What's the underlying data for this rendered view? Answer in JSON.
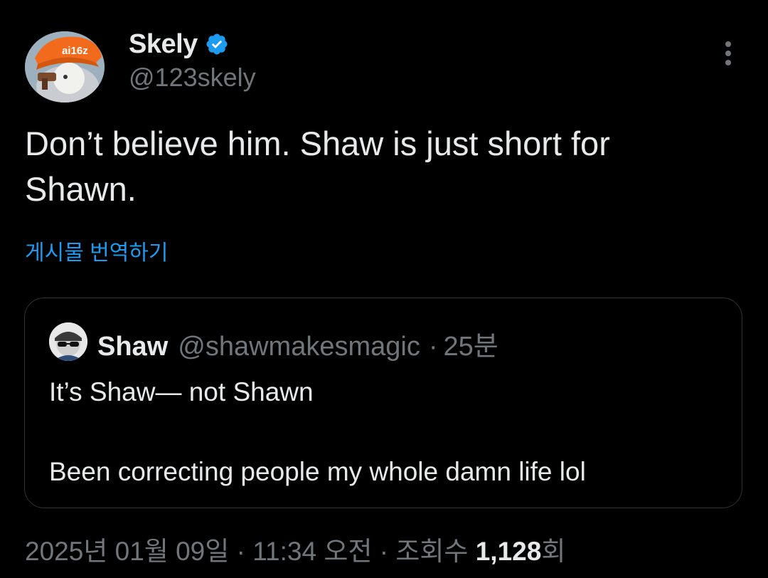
{
  "author": {
    "display_name": "Skely",
    "handle": "@123skely",
    "verified": true,
    "avatar_icon": "avatar-cap-character-icon",
    "cap_text": "ai16z"
  },
  "tweet": {
    "text": "Don’t believe him. Shaw is just short for\nShawn.",
    "translate_label": "게시물 번역하기"
  },
  "quoted_tweet": {
    "display_name": "Shaw",
    "handle": "@shawmakesmagic",
    "separator": "·",
    "time": "25분",
    "text": "It’s Shaw— not Shawn\n\nBeen correcting people my whole damn life lol",
    "avatar_icon": "avatar-sunglasses-icon"
  },
  "meta": {
    "date": "2025년 01월 09일",
    "sep1": " · ",
    "time": "11:34 오전",
    "sep2": " · ",
    "views_label": "조회수 ",
    "views_count": "1,128",
    "views_suffix": "회"
  },
  "colors": {
    "background": "#000000",
    "text": "#e7e9ea",
    "secondary": "#71767b",
    "link": "#1d9bf0",
    "border": "#2f3336"
  }
}
